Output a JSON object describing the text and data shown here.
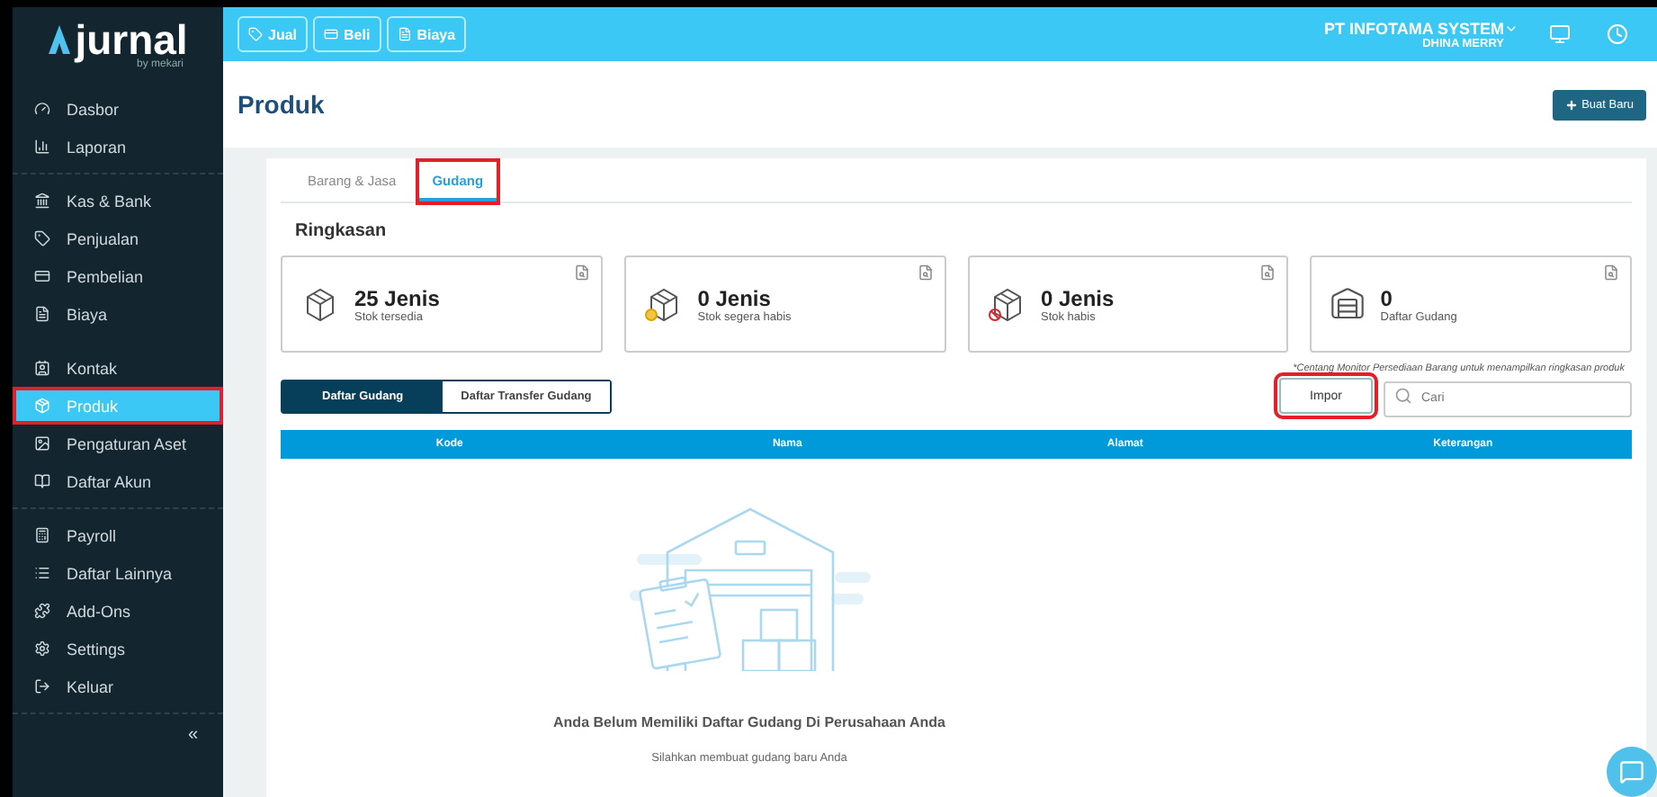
{
  "logo": {
    "name": "jurnal",
    "tagline": "by mekari"
  },
  "sidebar": {
    "groups": [
      {
        "items": [
          {
            "label": "Dasbor",
            "selected": false,
            "highlighted": false
          },
          {
            "label": "Laporan",
            "selected": false,
            "highlighted": false
          }
        ]
      },
      {
        "items": [
          {
            "label": "Kas & Bank",
            "selected": false,
            "highlighted": false
          },
          {
            "label": "Penjualan",
            "selected": false,
            "highlighted": false
          },
          {
            "label": "Pembelian",
            "selected": false,
            "highlighted": false
          },
          {
            "label": "Biaya",
            "selected": false,
            "highlighted": false
          },
          {
            "label": "Kontak",
            "selected": false,
            "highlighted": false
          },
          {
            "label": "Produk",
            "selected": true,
            "highlighted": true
          },
          {
            "label": "Pengaturan Aset",
            "selected": false,
            "highlighted": false
          },
          {
            "label": "Daftar Akun",
            "selected": false,
            "highlighted": false
          }
        ]
      },
      {
        "items": [
          {
            "label": "Payroll",
            "selected": false,
            "highlighted": false
          },
          {
            "label": "Daftar Lainnya",
            "selected": false,
            "highlighted": false
          },
          {
            "label": "Add-Ons",
            "selected": false,
            "highlighted": false
          },
          {
            "label": "Settings",
            "selected": false,
            "highlighted": false
          },
          {
            "label": "Keluar",
            "selected": false,
            "highlighted": false
          }
        ]
      }
    ],
    "collapse": "«"
  },
  "topbar": {
    "quick_buttons": [
      "Jual",
      "Beli",
      "Biaya"
    ],
    "company": "PT INFOTAMA SYSTEM",
    "user": "DHINA MERRY"
  },
  "header": {
    "title": "Produk",
    "create_button": "Buat Baru"
  },
  "tabs": [
    {
      "label": "Barang & Jasa",
      "selected": false,
      "highlighted": false
    },
    {
      "label": "Gudang",
      "selected": true,
      "highlighted": true
    }
  ],
  "summary": {
    "title": "Ringkasan",
    "cards": [
      {
        "value": "25",
        "unit": "Jenis",
        "label": "Stok tersedia"
      },
      {
        "value": "0",
        "unit": "Jenis",
        "label": "Stok segera habis"
      },
      {
        "value": "0",
        "unit": "Jenis",
        "label": "Stok habis"
      },
      {
        "value": "0",
        "label": "Daftar Gudang"
      }
    ],
    "note": "*Centang Monitor Persediaan Barang untuk menampilkan ringkasan produk"
  },
  "views": [
    {
      "label": "Daftar Gudang",
      "selected": true
    },
    {
      "label": "Daftar Transfer Gudang",
      "selected": false
    }
  ],
  "import_button": {
    "label": "Impor",
    "highlighted": true
  },
  "search": {
    "placeholder": "Cari"
  },
  "table": {
    "columns": [
      "Kode",
      "Nama",
      "Alamat",
      "Keterangan"
    ]
  },
  "empty_state": {
    "title": "Anda Belum Memiliki Daftar Gudang Di Perusahaan Anda",
    "subtitle": "Silahkan membuat gudang baru Anda"
  }
}
